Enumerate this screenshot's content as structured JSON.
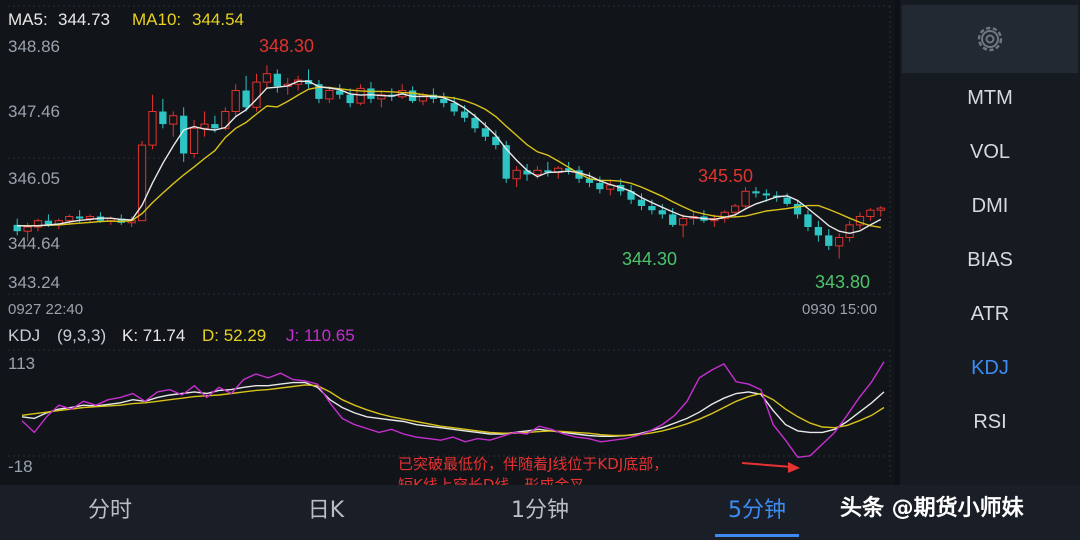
{
  "main_chart": {
    "ma_legend": {
      "ma5_label": "MA5:",
      "ma5_value": "344.73",
      "ma10_label": "MA10:",
      "ma10_value": "344.54"
    },
    "y_tick_labels": [
      "348.86",
      "347.46",
      "346.05",
      "344.64",
      "343.24"
    ],
    "x_start_label": "0927 22:40",
    "x_end_label": "0930 15:00",
    "annotations": {
      "high_label": "348.30",
      "low1_label": "344.30",
      "high2_label": "345.50",
      "low2_label": "343.80"
    }
  },
  "kdj_panel": {
    "name": "KDJ",
    "params": "(9,3,3)",
    "k_text": "K: 71.74",
    "d_text": "D: 52.29",
    "j_text": "J: 110.65",
    "y_tick_labels": [
      "113",
      "-18"
    ]
  },
  "note": {
    "line1": "已突破最低价，伴随着J线位于KDJ底部，",
    "line2": "短K线上穿长D线，形成金叉"
  },
  "sidebar": {
    "settings_icon": "gear-icon",
    "items": [
      "MTM",
      "VOL",
      "DMI",
      "BIAS",
      "ATR",
      "KDJ",
      "RSI"
    ],
    "active": "KDJ"
  },
  "tabs": {
    "items": [
      "分时",
      "日K",
      "1分钟",
      "5分钟"
    ],
    "active": "5分钟"
  },
  "watermark": "头条 @期货小师妹",
  "colors": {
    "up": "#e0342e",
    "down": "#2ec4c4",
    "ma5": "#e8e8e8",
    "ma10": "#d8c21a",
    "k": "#e8e8e8",
    "d": "#d8c21a",
    "j": "#c62fd0",
    "accent": "#3d8bf2",
    "annotation": "#e63232"
  },
  "chart_data": [
    {
      "type": "candlestick",
      "title": "",
      "xlabel": "",
      "ylabel": "",
      "ylim": [
        343.24,
        348.86
      ],
      "x_range": [
        "0927 22:40",
        "0930 15:00"
      ],
      "y_ticks": [
        348.86,
        347.46,
        346.05,
        344.64,
        343.24
      ],
      "grid": true,
      "ohlc": [
        [
          344.6,
          344.75,
          344.35,
          344.45
        ],
        [
          344.45,
          344.65,
          344.2,
          344.55
        ],
        [
          344.55,
          344.75,
          344.45,
          344.7
        ],
        [
          344.7,
          344.85,
          344.55,
          344.6
        ],
        [
          344.6,
          344.75,
          344.5,
          344.7
        ],
        [
          344.7,
          344.85,
          344.6,
          344.8
        ],
        [
          344.8,
          344.95,
          344.65,
          344.75
        ],
        [
          344.75,
          344.85,
          344.65,
          344.8
        ],
        [
          344.8,
          344.9,
          344.65,
          344.7
        ],
        [
          344.7,
          344.8,
          344.6,
          344.75
        ],
        [
          344.75,
          344.85,
          344.6,
          344.65
        ],
        [
          344.65,
          344.8,
          344.55,
          344.7
        ],
        [
          344.7,
          346.6,
          344.7,
          346.5
        ],
        [
          346.5,
          347.7,
          346.4,
          347.3
        ],
        [
          347.3,
          347.6,
          346.9,
          347.0
        ],
        [
          347.0,
          347.3,
          346.7,
          347.2
        ],
        [
          347.2,
          347.4,
          346.1,
          346.3
        ],
        [
          346.3,
          347.1,
          346.2,
          346.9
        ],
        [
          346.9,
          347.3,
          346.7,
          347.0
        ],
        [
          347.0,
          347.2,
          346.8,
          346.9
        ],
        [
          346.9,
          347.4,
          346.85,
          347.3
        ],
        [
          347.3,
          347.95,
          347.2,
          347.8
        ],
        [
          347.8,
          348.15,
          347.3,
          347.4
        ],
        [
          347.4,
          348.2,
          347.3,
          348.0
        ],
        [
          348.0,
          348.4,
          347.85,
          348.2
        ],
        [
          348.2,
          348.3,
          347.75,
          347.9
        ],
        [
          347.9,
          348.1,
          347.7,
          347.95
        ],
        [
          347.95,
          348.15,
          347.8,
          348.05
        ],
        [
          348.05,
          348.3,
          347.85,
          347.95
        ],
        [
          347.95,
          348.05,
          347.5,
          347.6
        ],
        [
          347.6,
          347.9,
          347.5,
          347.8
        ],
        [
          347.8,
          347.95,
          347.6,
          347.7
        ],
        [
          347.7,
          347.85,
          347.4,
          347.5
        ],
        [
          347.5,
          347.95,
          347.45,
          347.85
        ],
        [
          347.85,
          348.0,
          347.5,
          347.6
        ],
        [
          347.6,
          347.8,
          347.4,
          347.7
        ],
        [
          347.7,
          347.85,
          347.55,
          347.65
        ],
        [
          347.65,
          347.95,
          347.6,
          347.8
        ],
        [
          347.8,
          347.9,
          347.5,
          347.55
        ],
        [
          347.55,
          347.75,
          347.45,
          347.7
        ],
        [
          347.7,
          347.85,
          347.5,
          347.6
        ],
        [
          347.6,
          347.75,
          347.4,
          347.5
        ],
        [
          347.5,
          347.65,
          347.2,
          347.3
        ],
        [
          347.3,
          347.45,
          347.05,
          347.15
        ],
        [
          347.15,
          347.25,
          346.8,
          346.9
        ],
        [
          346.9,
          347.05,
          346.6,
          346.7
        ],
        [
          346.7,
          346.85,
          346.4,
          346.5
        ],
        [
          346.5,
          346.6,
          345.6,
          345.7
        ],
        [
          345.7,
          346.0,
          345.5,
          345.9
        ],
        [
          345.9,
          346.05,
          345.65,
          345.8
        ],
        [
          345.8,
          346.0,
          345.7,
          345.9
        ],
        [
          345.9,
          346.1,
          345.75,
          345.85
        ],
        [
          345.85,
          346.0,
          345.7,
          345.95
        ],
        [
          345.95,
          346.1,
          345.8,
          345.9
        ],
        [
          345.9,
          346.0,
          345.6,
          345.7
        ],
        [
          345.7,
          345.85,
          345.5,
          345.6
        ],
        [
          345.6,
          345.75,
          345.35,
          345.45
        ],
        [
          345.45,
          345.65,
          345.3,
          345.55
        ],
        [
          345.55,
          345.7,
          345.3,
          345.4
        ],
        [
          345.4,
          345.55,
          345.1,
          345.2
        ],
        [
          345.2,
          345.35,
          344.95,
          345.05
        ],
        [
          345.05,
          345.2,
          344.85,
          344.95
        ],
        [
          344.95,
          345.1,
          344.75,
          344.85
        ],
        [
          344.85,
          345.0,
          344.55,
          344.6
        ],
        [
          344.6,
          344.85,
          344.3,
          344.75
        ],
        [
          344.75,
          344.9,
          344.6,
          344.8
        ],
        [
          344.8,
          344.95,
          344.65,
          344.7
        ],
        [
          344.7,
          344.85,
          344.55,
          344.75
        ],
        [
          344.75,
          344.95,
          344.65,
          344.9
        ],
        [
          344.9,
          345.1,
          344.8,
          345.05
        ],
        [
          345.05,
          345.5,
          344.95,
          345.4
        ],
        [
          345.4,
          345.5,
          345.25,
          345.35
        ],
        [
          345.35,
          345.45,
          345.15,
          345.3
        ],
        [
          345.3,
          345.4,
          345.15,
          345.25
        ],
        [
          345.25,
          345.35,
          345.05,
          345.1
        ],
        [
          345.1,
          345.2,
          344.75,
          344.85
        ],
        [
          344.85,
          344.95,
          344.45,
          344.55
        ],
        [
          344.55,
          344.7,
          344.2,
          344.35
        ],
        [
          344.35,
          344.5,
          344.0,
          344.1
        ],
        [
          344.1,
          344.4,
          343.8,
          344.3
        ],
        [
          344.3,
          344.7,
          344.2,
          344.6
        ],
        [
          344.6,
          344.9,
          344.5,
          344.8
        ],
        [
          344.8,
          345.0,
          344.7,
          344.95
        ],
        [
          344.95,
          345.05,
          344.8,
          345.0
        ]
      ],
      "ma5": [
        344.58,
        344.57,
        344.58,
        344.6,
        344.62,
        344.67,
        344.71,
        344.73,
        344.76,
        344.76,
        344.73,
        344.72,
        345.07,
        345.6,
        346.07,
        346.48,
        346.86,
        346.94,
        346.88,
        346.86,
        346.92,
        347.18,
        347.34,
        347.59,
        347.86,
        347.88,
        347.91,
        348.02,
        348.02,
        347.89,
        347.86,
        347.82,
        347.72,
        347.69,
        347.7,
        347.68,
        347.67,
        347.72,
        347.66,
        347.66,
        347.66,
        347.63,
        347.53,
        347.38,
        347.19,
        346.97,
        346.73,
        346.41,
        346.14,
        345.9,
        345.75,
        345.85,
        345.86,
        345.88,
        345.84,
        345.77,
        345.65,
        345.56,
        345.49,
        345.4,
        345.25,
        345.13,
        345.02,
        344.91,
        344.81,
        344.78,
        344.75,
        344.73,
        344.78,
        344.84,
        344.98,
        345.1,
        345.18,
        345.27,
        345.29,
        345.18,
        344.99,
        344.79,
        344.58,
        344.45,
        344.4,
        344.46,
        344.6,
        344.73
      ],
      "ma10": [
        344.58,
        344.58,
        344.58,
        344.59,
        344.6,
        344.62,
        344.64,
        344.66,
        344.68,
        344.69,
        344.68,
        344.7,
        344.87,
        345.13,
        345.36,
        345.58,
        345.79,
        345.98,
        346.18,
        346.37,
        346.68,
        346.9,
        347.04,
        347.24,
        347.43,
        347.41,
        347.54,
        347.69,
        347.83,
        347.88,
        347.87,
        347.84,
        347.81,
        347.79,
        347.78,
        347.78,
        347.77,
        347.75,
        347.74,
        347.7,
        347.67,
        347.65,
        347.62,
        347.56,
        347.47,
        347.35,
        347.18,
        346.95,
        346.73,
        346.51,
        346.34,
        346.26,
        346.12,
        345.97,
        345.82,
        345.7,
        345.66,
        345.66,
        345.64,
        345.59,
        345.5,
        345.39,
        345.28,
        345.15,
        345.03,
        344.92,
        344.86,
        344.81,
        344.79,
        344.79,
        344.81,
        344.87,
        344.93,
        344.96,
        344.99,
        345.03,
        345.06,
        345.06,
        344.97,
        344.87,
        344.76,
        344.66,
        344.58,
        344.54
      ]
    },
    {
      "type": "line",
      "title": "",
      "xlabel": "",
      "ylabel": "",
      "ylim": [
        -18,
        113
      ],
      "y_ticks": [
        113,
        -18
      ],
      "series": [
        {
          "name": "K",
          "values": [
            40,
            38,
            45,
            50,
            52,
            55,
            54,
            56,
            58,
            62,
            60,
            65,
            68,
            70,
            72,
            70,
            74,
            75,
            78,
            80,
            80,
            82,
            84,
            84,
            78,
            62,
            52,
            45,
            40,
            38,
            36,
            34,
            30,
            28,
            26,
            24,
            22,
            20,
            18,
            18,
            20,
            22,
            24,
            22,
            20,
            18,
            16,
            15,
            15,
            16,
            18,
            22,
            26,
            32,
            38,
            46,
            56,
            64,
            70,
            72,
            69,
            48,
            30,
            22,
            20,
            20,
            24,
            34,
            46,
            58,
            72
          ]
        },
        {
          "name": "D",
          "values": [
            42,
            44,
            46,
            48,
            50,
            52,
            53,
            54,
            55,
            57,
            58,
            60,
            62,
            64,
            66,
            67,
            68,
            70,
            72,
            74,
            75,
            77,
            79,
            81,
            80,
            72,
            62,
            55,
            49,
            44,
            40,
            37,
            34,
            31,
            28,
            26,
            24,
            22,
            20,
            19,
            19,
            20,
            21,
            22,
            21,
            20,
            19,
            17,
            16,
            16,
            17,
            19,
            22,
            26,
            31,
            37,
            44,
            52,
            60,
            66,
            70,
            62,
            50,
            40,
            32,
            27,
            26,
            29,
            35,
            42,
            52
          ]
        },
        {
          "name": "J",
          "values": [
            35,
            20,
            40,
            55,
            50,
            60,
            55,
            62,
            65,
            70,
            60,
            72,
            75,
            68,
            80,
            65,
            78,
            70,
            88,
            95,
            90,
            96,
            88,
            86,
            82,
            58,
            38,
            30,
            25,
            20,
            24,
            18,
            14,
            12,
            10,
            14,
            8,
            12,
            10,
            15,
            20,
            18,
            28,
            24,
            18,
            14,
            12,
            8,
            10,
            12,
            16,
            22,
            30,
            42,
            60,
            90,
            100,
            108,
            85,
            82,
            75,
            30,
            10,
            -12,
            -10,
            5,
            20,
            42,
            65,
            85,
            110.65
          ]
        }
      ]
    }
  ]
}
